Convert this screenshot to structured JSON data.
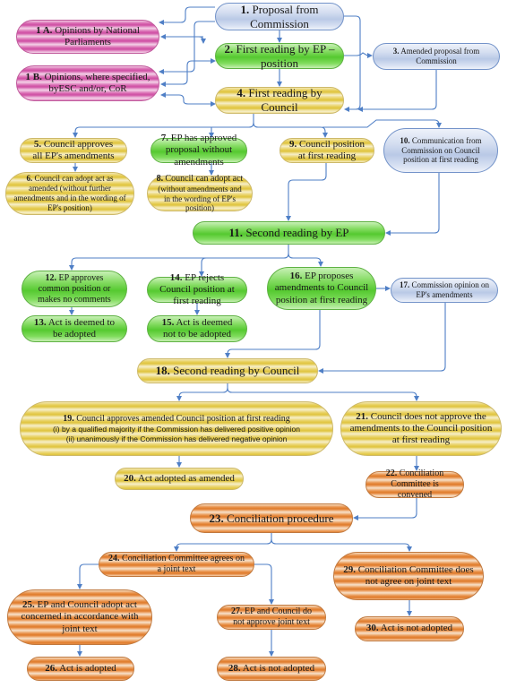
{
  "colors": {
    "connector": "#4f7fc6",
    "commission": "#b9c9e6",
    "parliament": "#55c930",
    "council": "#dfc43e",
    "advisory": "#cf4ea3",
    "conciliation": "#df7a2a"
  },
  "nodes": {
    "n1": {
      "num": "1.",
      "text": "Proposal from Commission"
    },
    "n1a": {
      "num": "1 A.",
      "text": "Opinions by National Parliaments"
    },
    "n1b": {
      "num": "1 B.",
      "text": "Opinions, where specified, byESC and/or, CoR"
    },
    "n2": {
      "num": "2.",
      "text": "First reading by EP – position"
    },
    "n3": {
      "num": "3.",
      "text": "Amended proposal from Commission"
    },
    "n4": {
      "num": "4.",
      "text": "First reading by Council"
    },
    "n5": {
      "num": "5.",
      "text": "Council approves all EP's amendments"
    },
    "n6": {
      "num": "6.",
      "text": "Council can adopt act as amended (without further amendments and in the wording of EP's position)"
    },
    "n7": {
      "num": "7.",
      "text": "EP has approved proposal without amendments"
    },
    "n8": {
      "num": "8.",
      "text": "Council can adopt act",
      "note": "(without amendments and in the wording of EP's position)"
    },
    "n9": {
      "num": "9.",
      "text": "Council position at first reading"
    },
    "n10": {
      "num": "10.",
      "text": "Communication from Commission on Council position at first reading"
    },
    "n11": {
      "num": "11.",
      "text": "Second reading by EP"
    },
    "n12": {
      "num": "12.",
      "text": "EP approves common position or makes no comments"
    },
    "n13": {
      "num": "13.",
      "text": "Act is deemed to be adopted"
    },
    "n14": {
      "num": "14.",
      "text": "EP rejects Council position at first reading"
    },
    "n15": {
      "num": "15.",
      "text": "Act is deemed not to be adopted"
    },
    "n16": {
      "num": "16.",
      "text": "EP proposes amendments to Council position at first reading"
    },
    "n17": {
      "num": "17.",
      "text": "Commission opinion on EP's amendments"
    },
    "n18": {
      "num": "18.",
      "text": "Second reading by Council"
    },
    "n19": {
      "num": "19.",
      "text": "Council approves amended Council position at first reading",
      "line1": "(i) by a qualified majority if the Commission has delivered positive opinion",
      "line2": "(ii) unanimously if the Commission has delivered negative opinion"
    },
    "n20": {
      "num": "20.",
      "text": "Act adopted as amended"
    },
    "n21": {
      "num": "21.",
      "text": "Council does not approve the amendments to the Council position at first reading"
    },
    "n22": {
      "num": "22.",
      "text": "Conciliation Committee is convened"
    },
    "n23": {
      "num": "23.",
      "text": "Conciliation procedure"
    },
    "n24": {
      "num": "24.",
      "text": "Conciliation Committee agrees on a joint text"
    },
    "n25": {
      "num": "25.",
      "text": "EP and Council adopt act concerned in accordance with joint text"
    },
    "n26": {
      "num": "26.",
      "text": "Act is adopted"
    },
    "n27": {
      "num": "27.",
      "text": "EP and Council do not approve joint text"
    },
    "n28": {
      "num": "28.",
      "text": "Act is not adopted"
    },
    "n29": {
      "num": "29.",
      "text": "Conciliation Committee does not agree on joint text"
    },
    "n30": {
      "num": "30.",
      "text": "Act is not adopted"
    }
  }
}
